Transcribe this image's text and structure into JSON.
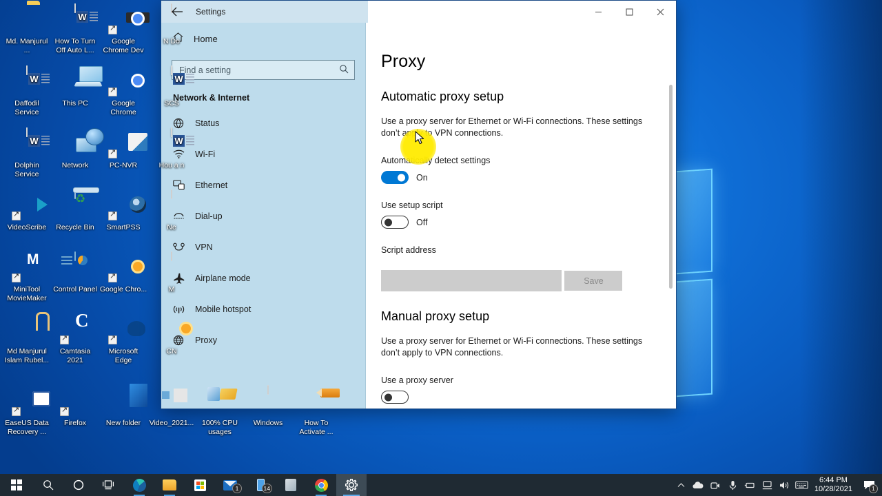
{
  "desktop": {
    "icons": [
      {
        "label": "Md. Manjurul ...",
        "art": "folder-user",
        "shortcut": false,
        "col": 0,
        "row": 0
      },
      {
        "label": "How To Turn Off Auto L...",
        "art": "word",
        "shortcut": false,
        "col": 1,
        "row": 0
      },
      {
        "label": "Google Chrome Dev",
        "art": "chrome-dev",
        "shortcut": true,
        "col": 2,
        "row": 0
      },
      {
        "label": "N Do",
        "art": "notepad",
        "shortcut": false,
        "col": 3,
        "row": 0
      },
      {
        "label": "Daffodil Service",
        "art": "word",
        "shortcut": false,
        "col": 0,
        "row": 1
      },
      {
        "label": "This PC",
        "art": "this-pc",
        "shortcut": false,
        "col": 1,
        "row": 1
      },
      {
        "label": "Google Chrome",
        "art": "chrome",
        "shortcut": true,
        "col": 2,
        "row": 1
      },
      {
        "label": "SCS",
        "art": "word",
        "shortcut": false,
        "col": 3,
        "row": 1
      },
      {
        "label": "Dolphin Service",
        "art": "word",
        "shortcut": false,
        "col": 0,
        "row": 2
      },
      {
        "label": "Network",
        "art": "network",
        "shortcut": false,
        "col": 1,
        "row": 2
      },
      {
        "label": "PC-NVR",
        "art": "pcnvr",
        "shortcut": true,
        "col": 2,
        "row": 2
      },
      {
        "label": "Hou a n",
        "art": "word",
        "shortcut": false,
        "col": 3,
        "row": 2
      },
      {
        "label": "VideoScribe",
        "art": "videoscribe",
        "shortcut": true,
        "col": 0,
        "row": 3
      },
      {
        "label": "Recycle Bin",
        "art": "recycle",
        "shortcut": false,
        "col": 1,
        "row": 3
      },
      {
        "label": "SmartPSS",
        "art": "smartpss",
        "shortcut": true,
        "col": 2,
        "row": 3
      },
      {
        "label": "Ne",
        "art": "notepad",
        "shortcut": false,
        "col": 3,
        "row": 3
      },
      {
        "label": "MiniTool MovieMaker",
        "art": "minitool",
        "shortcut": true,
        "col": 0,
        "row": 4
      },
      {
        "label": "Control Panel",
        "art": "control-panel",
        "shortcut": false,
        "col": 1,
        "row": 4
      },
      {
        "label": "Google Chro...",
        "art": "canary",
        "shortcut": true,
        "col": 2,
        "row": 4
      },
      {
        "label": "M",
        "art": "notepad",
        "shortcut": false,
        "col": 3,
        "row": 4
      },
      {
        "label": "Md Manjurul Islam Rubel...",
        "art": "winrar",
        "shortcut": false,
        "col": 0,
        "row": 5
      },
      {
        "label": "Camtasia 2021",
        "art": "camtasia",
        "shortcut": true,
        "col": 1,
        "row": 5
      },
      {
        "label": "Microsoft Edge",
        "art": "edge",
        "shortcut": true,
        "col": 2,
        "row": 5
      },
      {
        "label": "CN",
        "art": "canary",
        "shortcut": false,
        "col": 3,
        "row": 5
      },
      {
        "label": "EaseUS Data Recovery ...",
        "art": "easeus",
        "shortcut": true,
        "col": 0,
        "row": 6
      },
      {
        "label": "Firefox",
        "art": "firefox",
        "shortcut": true,
        "col": 1,
        "row": 6
      },
      {
        "label": "New folder",
        "art": "folder-blue",
        "shortcut": false,
        "col": 2,
        "row": 6
      },
      {
        "label": "Video_2021...",
        "art": "video",
        "shortcut": false,
        "col": 3,
        "row": 6
      },
      {
        "label": "100% CPU usages",
        "art": "cpu",
        "shortcut": false,
        "col": 4,
        "row": 6
      },
      {
        "label": "Windows",
        "art": "notepad",
        "shortcut": false,
        "col": 5,
        "row": 6
      },
      {
        "label": "How To Activate ...",
        "art": "pencil",
        "shortcut": false,
        "col": 6,
        "row": 6
      }
    ]
  },
  "window": {
    "title": "Settings",
    "back_icon": "back-arrow-icon",
    "minimize_label": "—",
    "maximize_label": "☐",
    "close_label": "✕"
  },
  "sidebar": {
    "home_label": "Home",
    "home_icon": "home-icon",
    "search": {
      "placeholder": "Find a setting",
      "value": "",
      "icon": "search-icon"
    },
    "section_title": "Network & Internet",
    "items": [
      {
        "label": "Status",
        "icon": "globe-status-icon"
      },
      {
        "label": "Wi-Fi",
        "icon": "wifi-icon"
      },
      {
        "label": "Ethernet",
        "icon": "ethernet-icon"
      },
      {
        "label": "Dial-up",
        "icon": "dialup-icon"
      },
      {
        "label": "VPN",
        "icon": "vpn-icon"
      },
      {
        "label": "Airplane mode",
        "icon": "airplane-icon"
      },
      {
        "label": "Mobile hotspot",
        "icon": "hotspot-icon"
      },
      {
        "label": "Proxy",
        "icon": "globe-proxy-icon"
      }
    ]
  },
  "main": {
    "page_title": "Proxy",
    "automatic": {
      "heading": "Automatic proxy setup",
      "description": "Use a proxy server for Ethernet or Wi-Fi connections. These settings don’t apply to VPN connections.",
      "auto_detect_label": "Automatically detect settings",
      "auto_detect_state": "On",
      "setup_script_label": "Use setup script",
      "setup_script_state": "Off",
      "script_address_label": "Script address",
      "script_address_value": "",
      "save_label": "Save"
    },
    "manual": {
      "heading": "Manual proxy setup",
      "description": "Use a proxy server for Ethernet or Wi-Fi connections. These settings don’t apply to VPN connections.",
      "use_proxy_label": "Use a proxy server"
    }
  },
  "taskbar": {
    "start_icon": "windows-start-icon",
    "items": [
      {
        "name": "search-icon",
        "badge": ""
      },
      {
        "name": "cortana-icon",
        "badge": ""
      },
      {
        "name": "task-view-icon",
        "badge": ""
      },
      {
        "name": "edge-icon",
        "badge": ""
      },
      {
        "name": "file-explorer-icon",
        "badge": ""
      },
      {
        "name": "microsoft-store-icon",
        "badge": ""
      },
      {
        "name": "mail-icon",
        "badge": "1"
      },
      {
        "name": "your-phone-icon",
        "badge": "14"
      },
      {
        "name": "onenote-icon",
        "badge": ""
      },
      {
        "name": "chrome-icon",
        "badge": ""
      },
      {
        "name": "settings-icon",
        "badge": ""
      }
    ],
    "tray": {
      "show_hidden_icon": "chevron-up-icon",
      "icons": [
        "onedrive-icon",
        "camera-icon",
        "microphone-icon",
        "usb-icon",
        "network-icon",
        "volume-icon",
        "keyboard-icon"
      ],
      "clock_time": "6:44 PM",
      "clock_date": "10/28/2021",
      "notification_icon": "action-center-icon",
      "notification_count": "1"
    }
  },
  "colors": {
    "accent": "#0078d4",
    "sidebar_bg": "#bedcec",
    "titlebar_bg": "#cfe3ef",
    "taskbar_bg": "#1f2a33",
    "highlight": "#ffe800",
    "desktop_blue": "#0f6ed6"
  }
}
